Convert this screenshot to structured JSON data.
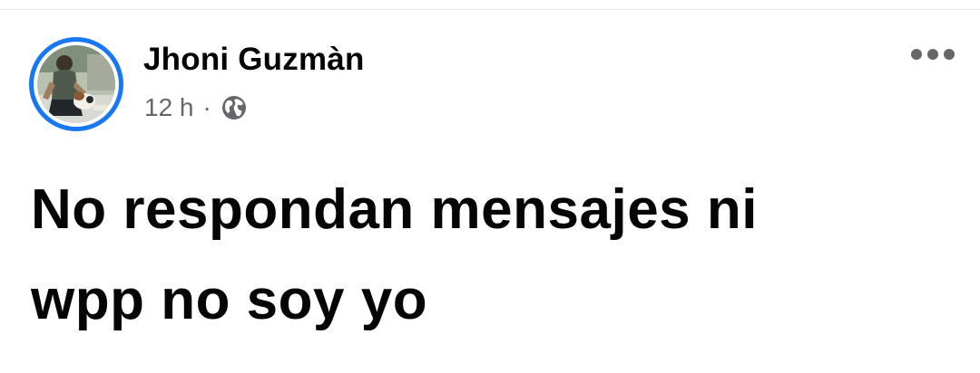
{
  "post": {
    "author": {
      "name": "Jhoni Guzmàn",
      "avatar_icon": "profile-photo"
    },
    "meta": {
      "time": "12 h",
      "separator": "·",
      "audience_icon": "globe-icon"
    },
    "more_icon": "more-options-icon",
    "text_lines": [
      "No respondan mensajes ni",
      "wpp no soy yo"
    ]
  },
  "colors": {
    "accent": "#1877f2",
    "text_primary": "#050505",
    "text_secondary": "#65676b",
    "divider": "#e4e6eb"
  }
}
